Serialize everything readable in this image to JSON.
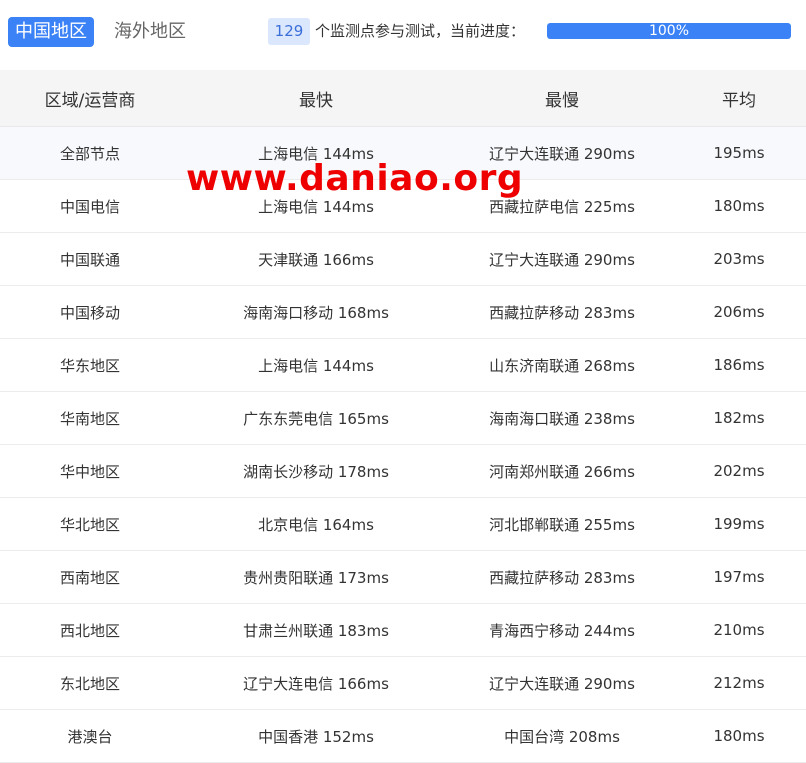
{
  "tabs": [
    {
      "label": "中国地区",
      "active": true
    },
    {
      "label": "海外地区",
      "active": false
    }
  ],
  "progress": {
    "count": "129",
    "text": "个监测点参与测试，当前进度：",
    "percent_label": "100%",
    "percent_value": 100
  },
  "table": {
    "headers": [
      "区域/运营商",
      "最快",
      "最慢",
      "平均"
    ],
    "rows": [
      [
        "全部节点",
        "上海电信 144ms",
        "辽宁大连联通 290ms",
        "195ms"
      ],
      [
        "中国电信",
        "上海电信 144ms",
        "西藏拉萨电信 225ms",
        "180ms"
      ],
      [
        "中国联通",
        "天津联通 166ms",
        "辽宁大连联通 290ms",
        "203ms"
      ],
      [
        "中国移动",
        "海南海口移动 168ms",
        "西藏拉萨移动 283ms",
        "206ms"
      ],
      [
        "华东地区",
        "上海电信 144ms",
        "山东济南联通 268ms",
        "186ms"
      ],
      [
        "华南地区",
        "广东东莞电信 165ms",
        "海南海口联通 238ms",
        "182ms"
      ],
      [
        "华中地区",
        "湖南长沙移动 178ms",
        "河南郑州联通 266ms",
        "202ms"
      ],
      [
        "华北地区",
        "北京电信 164ms",
        "河北邯郸联通 255ms",
        "199ms"
      ],
      [
        "西南地区",
        "贵州贵阳联通 173ms",
        "西藏拉萨移动 283ms",
        "197ms"
      ],
      [
        "西北地区",
        "甘肃兰州联通 183ms",
        "青海西宁移动 244ms",
        "210ms"
      ],
      [
        "东北地区",
        "辽宁大连电信 166ms",
        "辽宁大连联通 290ms",
        "212ms"
      ],
      [
        "港澳台",
        "中国香港 152ms",
        "中国台湾 208ms",
        "180ms"
      ]
    ]
  },
  "watermark": "www.daniao.org",
  "colors": {
    "accent": "#3b82f6",
    "watermark": "#ee0000"
  }
}
